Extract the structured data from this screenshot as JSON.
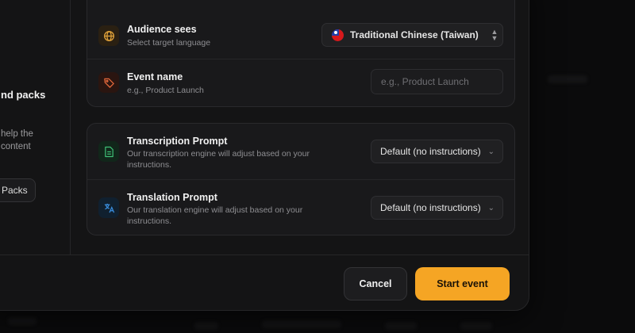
{
  "sidebar": {
    "title": "nd packs",
    "description": "help the\ncontent",
    "button_label": "Packs"
  },
  "language_row": {
    "title": "Audience sees",
    "subtitle": "Select target language",
    "selected_language": "Traditional Chinese (Taiwan)",
    "icon": "globe-icon"
  },
  "event_row": {
    "title": "Event name",
    "subtitle": "e.g., Product Launch",
    "input_placeholder": "e.g., Product Launch",
    "icon": "tag-icon"
  },
  "transcription_row": {
    "title": "Transcription Prompt",
    "subtitle": "Our transcription engine will adjust based on your instructions.",
    "selected": "Default (no instructions)",
    "icon": "document-icon"
  },
  "translation_row": {
    "title": "Translation Prompt",
    "subtitle": "Our translation engine will adjust based on your instructions.",
    "selected": "Default (no instructions)",
    "icon": "translate-icon"
  },
  "footer": {
    "cancel_label": "Cancel",
    "start_label": "Start event"
  },
  "colors": {
    "accent": "#f5a524",
    "globe_icon": "#e0a23a",
    "tag_icon": "#e0663a",
    "doc_icon": "#3fbf76",
    "translate_icon": "#3a8fe0"
  }
}
